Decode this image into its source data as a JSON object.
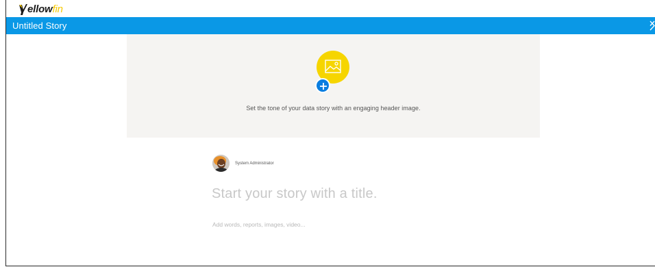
{
  "app": {
    "logo_text_a": "ellow",
    "logo_text_b": "fin",
    "brand_yellow": "#f6c800",
    "accent_blue": "#0a98e6"
  },
  "title_bar": {
    "title": "Untitled Story",
    "close_icon": "close-icon"
  },
  "header_image": {
    "icon": "image-icon",
    "add_icon": "plus-icon",
    "hint": "Set the tone of your data story with an engaging header image."
  },
  "author": {
    "name": "System Administrator"
  },
  "story": {
    "title_placeholder": "Start your story with a title.",
    "body_placeholder": "Add words, reports, images, video..."
  }
}
